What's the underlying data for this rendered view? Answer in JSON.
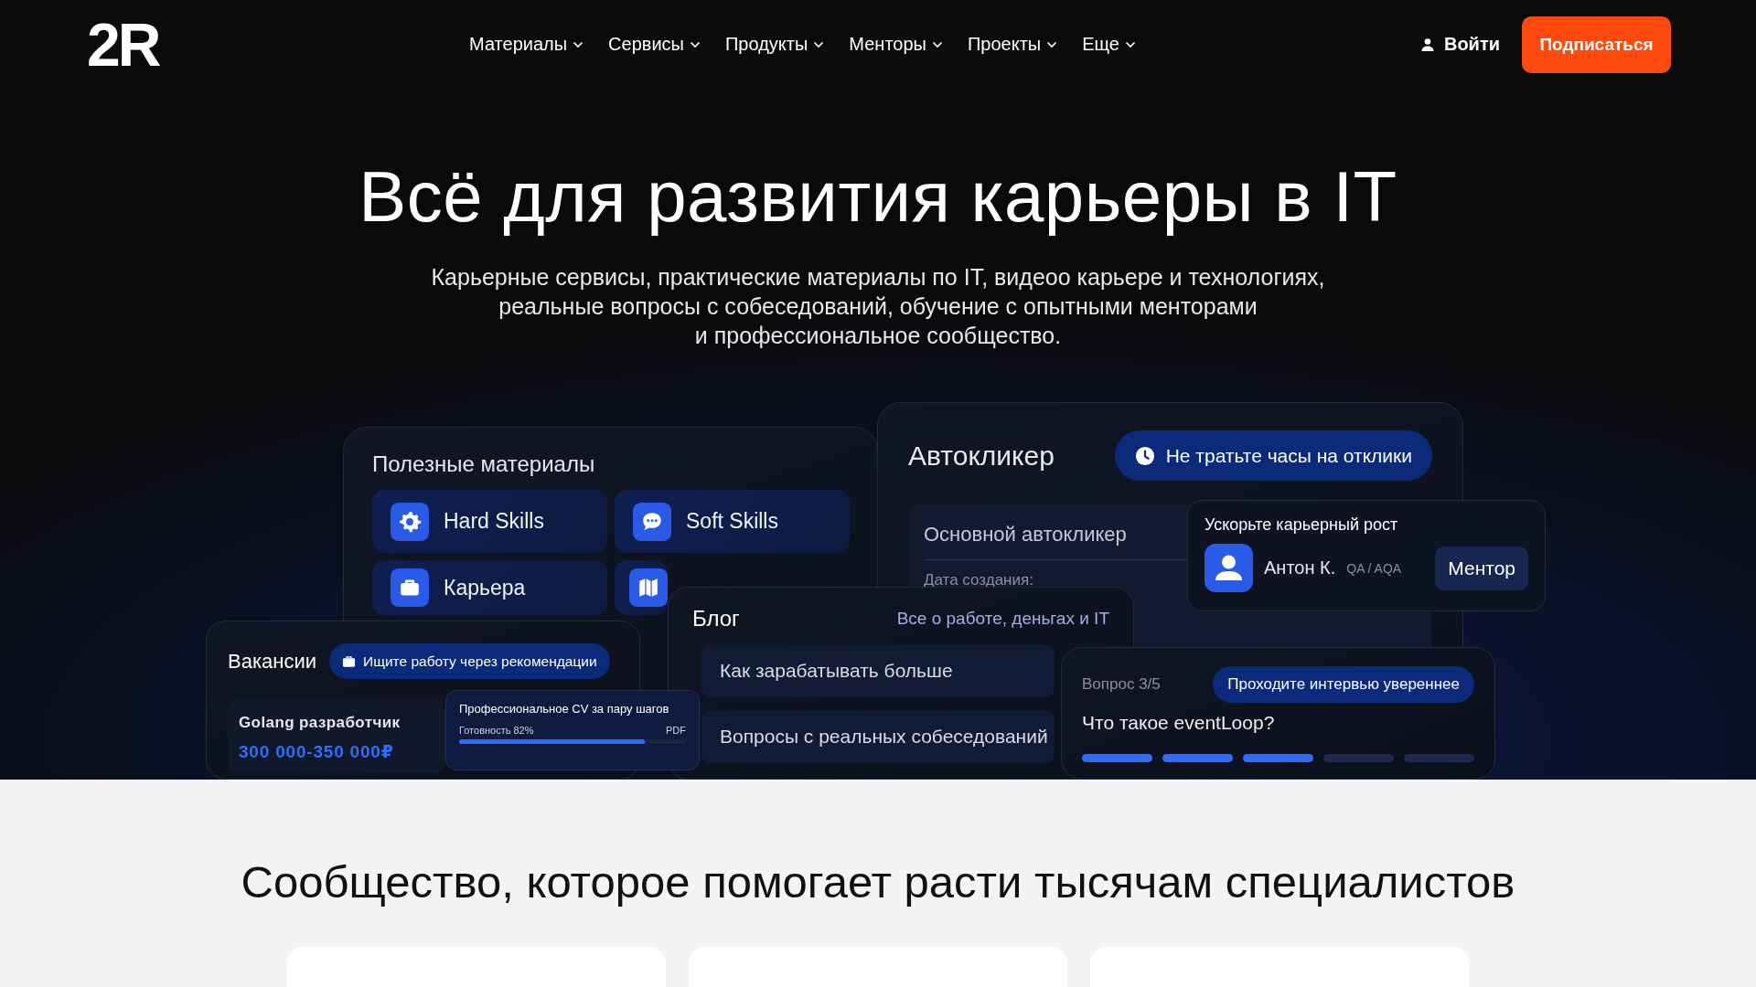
{
  "header": {
    "logo": "2R",
    "nav": [
      {
        "label": "Материалы"
      },
      {
        "label": "Сервисы"
      },
      {
        "label": "Продукты"
      },
      {
        "label": "Менторы"
      },
      {
        "label": "Проекты"
      },
      {
        "label": "Еще"
      }
    ],
    "login": "Войти",
    "subscribe": "Подписаться"
  },
  "hero": {
    "title": "Всё для развития карьеры в IT",
    "subtitle_lines": [
      "Карьерные сервисы, практические материалы по IT, видеоо карьере и технологиях,",
      "реальные вопросы с собеседований, обучение с опытными менторами",
      "и профессиональное сообщество."
    ]
  },
  "materials": {
    "title": "Полезные материалы",
    "tiles": [
      {
        "label": "Hard Skills"
      },
      {
        "label": "Soft Skills"
      },
      {
        "label": "Карьера"
      },
      {
        "kind": "icon-only"
      }
    ]
  },
  "autoclicker": {
    "title": "Автокликер",
    "badge": "Не тратьте часы на отклики",
    "panel_title": "Основной автокликер",
    "panel_field": "Дата создания:"
  },
  "mentor": {
    "title": "Ускорьте карьерный рост",
    "name": "Антон К.",
    "role": "QA / AQA",
    "button": "Ментор"
  },
  "blog": {
    "title": "Блог",
    "tagline": "Все о работе, деньгах и IT",
    "items": [
      "Как зарабатывать больше",
      "Вопросы с реальных собеседований"
    ]
  },
  "vacancies": {
    "title": "Вакансии",
    "badge": "Ищите работу через рекомендации",
    "job_title": "Golang разработчик",
    "salary": "300 000-350 000₽"
  },
  "cv": {
    "title": "Профессиональное CV за пару шагов",
    "progress_label": "Готовность 82%",
    "format": "PDF",
    "level": 0.82
  },
  "question": {
    "counter": "Вопрос 3/5",
    "badge": "Проходите интервью увереннее",
    "text": "Что такое eventLoop?",
    "steps": [
      {
        "done": true
      },
      {
        "done": true
      },
      {
        "done": true
      },
      {
        "done": false
      },
      {
        "done": false
      }
    ]
  },
  "community": {
    "title": "Сообщество, которое помогает расти тысячам специалистов",
    "cards": [
      {
        "kind": "card"
      },
      {
        "kind": "card"
      },
      {
        "kind": "card"
      }
    ]
  }
}
